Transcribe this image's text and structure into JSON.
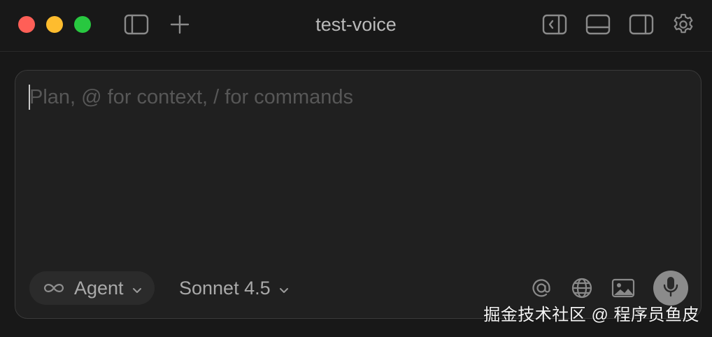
{
  "window": {
    "title": "test-voice"
  },
  "titlebar": {
    "left_icons": [
      "sidebar-toggle-icon",
      "plus-icon"
    ],
    "right_icons": [
      "panel-left-collapse-icon",
      "panel-bottom-icon",
      "panel-right-icon",
      "gear-icon"
    ]
  },
  "composer": {
    "placeholder": "Plan, @ for context, / for commands",
    "value": "",
    "mode": {
      "label": "Agent",
      "icon": "infinity-icon"
    },
    "model": {
      "label": "Sonnet 4.5"
    },
    "actions": [
      "at-mention-icon",
      "globe-icon",
      "image-icon",
      "microphone-icon"
    ]
  },
  "watermark": {
    "text": "掘金技术社区 @ 程序员鱼皮"
  },
  "colors": {
    "background": "#181818",
    "composer_bg": "#202020",
    "text": "#a9a9a9",
    "placeholder": "#575757",
    "close": "#ff5f57",
    "minimize": "#febc2e",
    "maximize": "#28c840",
    "mic_button": "#8b8b8b"
  }
}
